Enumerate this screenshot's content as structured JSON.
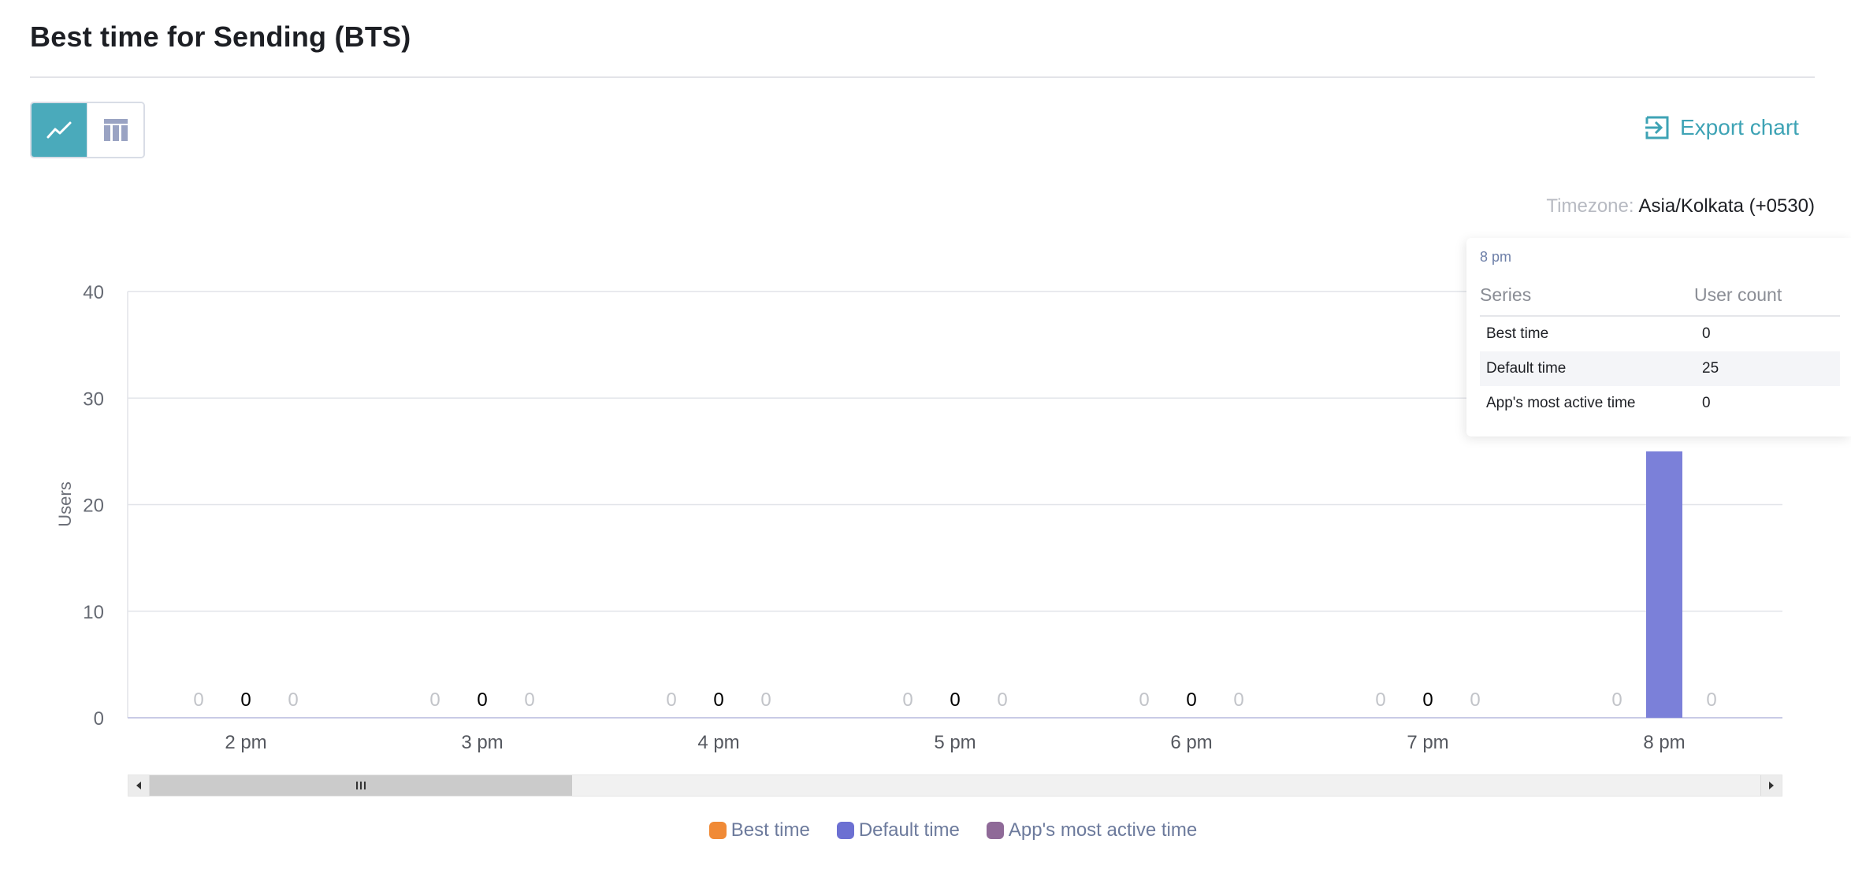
{
  "header": {
    "title": "Best time for Sending (BTS)"
  },
  "toolbar": {
    "view_buttons": [
      {
        "icon": "line-chart-icon",
        "active": true
      },
      {
        "icon": "table-icon",
        "active": false
      }
    ],
    "export_label": "Export chart",
    "export_icon": "export-icon"
  },
  "timezone": {
    "label": "Timezone:",
    "value": "Asia/Kolkata (+0530)"
  },
  "colors": {
    "accent": "#4aaabb",
    "best_time": "#f08a36",
    "default_time": "#7b80d9",
    "app_active": "#8f6a98"
  },
  "chart_data": {
    "type": "bar",
    "categories": [
      "2 pm",
      "3 pm",
      "4 pm",
      "5 pm",
      "6 pm",
      "7 pm",
      "8 pm"
    ],
    "series": [
      {
        "name": "Best time",
        "color": "#f08a36",
        "values": [
          0,
          0,
          0,
          0,
          0,
          0,
          0
        ]
      },
      {
        "name": "Default time",
        "color": "#7b80d9",
        "values": [
          0,
          0,
          0,
          0,
          0,
          0,
          25
        ]
      },
      {
        "name": "App's most active time",
        "color": "#8f6a98",
        "values": [
          0,
          0,
          0,
          0,
          0,
          0,
          0
        ]
      }
    ],
    "ylabel": "Users",
    "xlabel": "",
    "ylim": [
      0,
      40
    ],
    "yticks": [
      0,
      10,
      20,
      30,
      40
    ],
    "grid": true,
    "legend": "bottom"
  },
  "tooltip": {
    "title": "8 pm",
    "col_series": "Series",
    "col_count": "User count",
    "rows": [
      {
        "series": "Best time",
        "count": "0"
      },
      {
        "series": "Default time",
        "count": "25"
      },
      {
        "series": "App's most active time",
        "count": "0"
      }
    ]
  },
  "legend": {
    "items": [
      "Best time",
      "Default time",
      "App's most active time"
    ]
  }
}
